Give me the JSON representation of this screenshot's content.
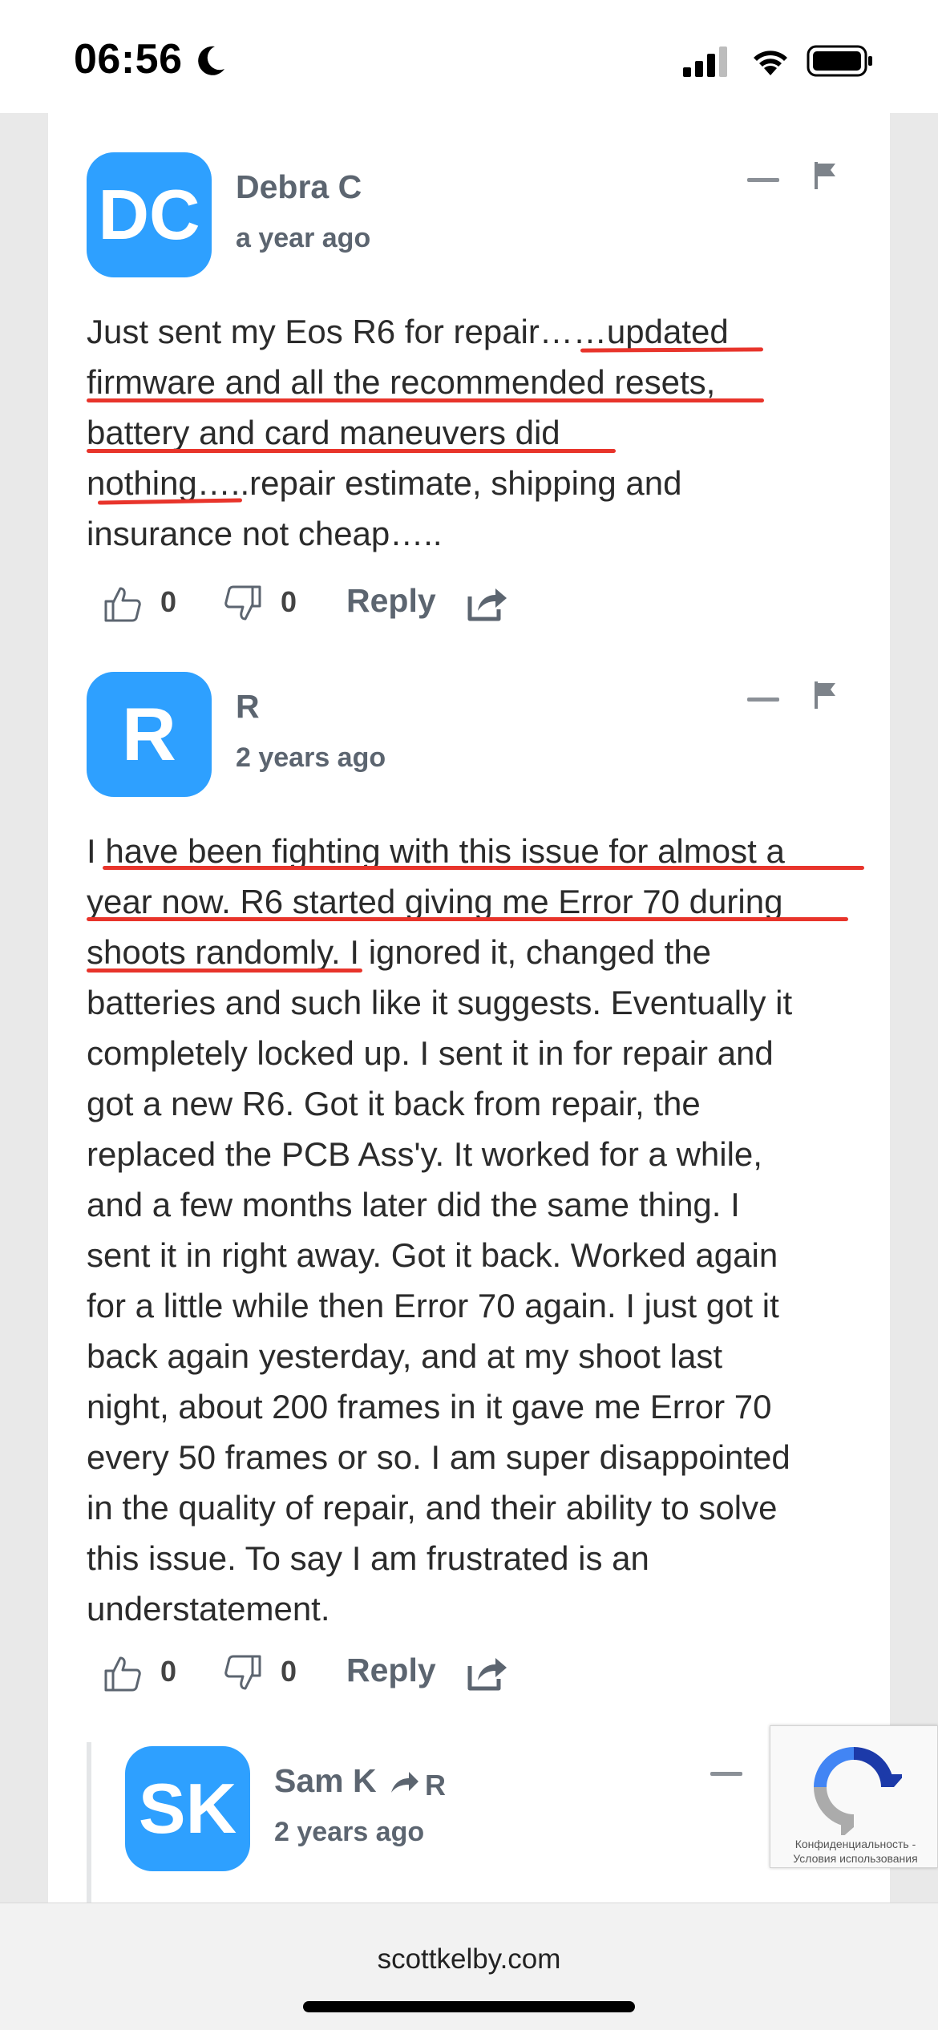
{
  "status_bar": {
    "time": "06:56"
  },
  "comments": [
    {
      "initials": "DC",
      "author": "Debra C",
      "time": "a year ago",
      "lines": [
        "Just sent my Eos R6 for repair……updated",
        "firmware and all the recommended resets,",
        "battery and card maneuvers did",
        "nothing…..repair estimate, shipping and",
        "insurance not cheap….."
      ],
      "likes": "0",
      "dislikes": "0",
      "reply_label": "Reply"
    },
    {
      "initials": "R",
      "author": "R",
      "time": "2 years ago",
      "lines": [
        "I have been fighting with this issue for almost a",
        "year now. R6 started giving me Error 70 during",
        "shoots randomly. I ignored it, changed the",
        "batteries and such like it suggests. Eventually it",
        "completely locked up. I sent it in for repair and",
        "got a new R6. Got it back from repair, the",
        "replaced the PCB Ass'y. It worked for a while,",
        "and a few months later did the same thing. I",
        "sent it in right away. Got it back. Worked again",
        "for a little while then Error 70 again. I just got it",
        "back again yesterday, and at my shoot last",
        "night, about 200 frames in it gave me Error 70",
        "every 50 frames or so. I am super disappointed",
        "in the quality of repair, and their ability to solve",
        "this issue. To say I am frustrated is an",
        "understatement."
      ],
      "likes": "0",
      "dislikes": "0",
      "reply_label": "Reply"
    },
    {
      "initials": "SK",
      "author": "Sam K",
      "reply_to": "R",
      "time": "2 years ago"
    }
  ],
  "recaptcha": {
    "line1": "Конфиденциальность -",
    "line2": "Условия использования"
  },
  "browser": {
    "url": "scottkelby.com"
  },
  "colors": {
    "avatar": "#2ea0ff",
    "underline": "#e8342b"
  }
}
